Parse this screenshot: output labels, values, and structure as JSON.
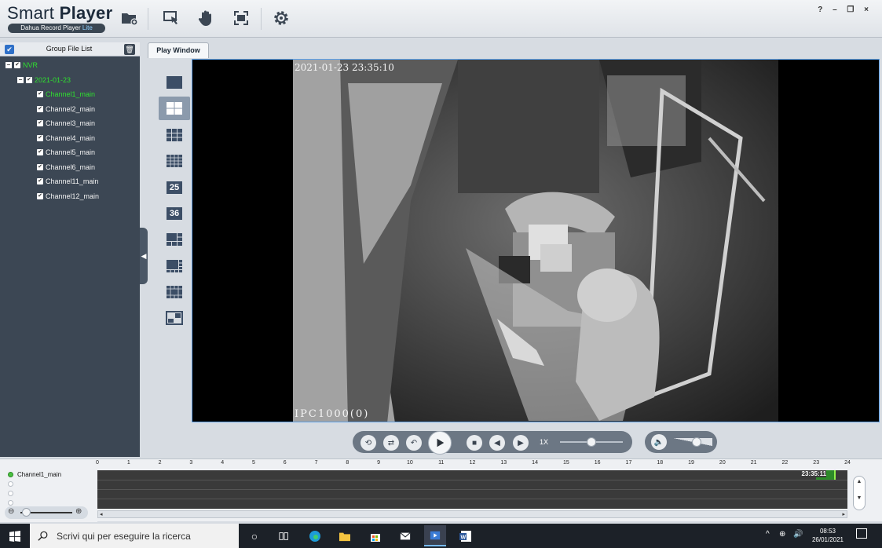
{
  "app": {
    "title_light": "Smart ",
    "title_bold": "Player",
    "subtitle": "Dahua Record Player ",
    "subtitle_lite": "Lite",
    "window_controls": "? – ❐ ×"
  },
  "toolbar": {
    "icons": [
      "open-folder-icon",
      "snapshot-cursor-icon",
      "hand-icon",
      "fullscreen-icon",
      "settings-gear-icon"
    ]
  },
  "group_panel": {
    "title": "Group File List",
    "tree": {
      "root": "NVR",
      "date": "2021-01-23",
      "channels": [
        "Channel1_main",
        "Channel2_main",
        "Channel3_main",
        "Channel4_main",
        "Channel5_main",
        "Channel6_main",
        "Channel11_main",
        "Channel12_main"
      ],
      "active_channel": "Channel1_main"
    }
  },
  "play_window": {
    "tab_label": "Play Window",
    "layouts": [
      "1",
      "4",
      "9",
      "16",
      "25",
      "36",
      "6",
      "8",
      "13",
      "pip"
    ],
    "layout_25": "25",
    "layout_36": "36",
    "selected_layout": "4",
    "timestamp": "2021-01-23 23:35:10",
    "camera_name": "IPC1000(0)"
  },
  "playback": {
    "speed_label": "1X",
    "speed_level": 0.5,
    "volume_level": 0.6
  },
  "timeline": {
    "channel_label": "Channel1_main",
    "hours": [
      "0",
      "1",
      "2",
      "3",
      "4",
      "5",
      "6",
      "7",
      "8",
      "9",
      "10",
      "11",
      "12",
      "13",
      "14",
      "15",
      "16",
      "17",
      "18",
      "19",
      "20",
      "21",
      "22",
      "23",
      "24"
    ],
    "current_time": "23:35:11",
    "zoom_level": 0.1
  },
  "taskbar": {
    "search_placeholder": "Scrivi qui per eseguire la ricerca",
    "time": "08:53",
    "date": "26/01/2021"
  },
  "colors": {
    "accent": "#2f70c8",
    "tree_active": "#2fe02f",
    "panel_dark": "#3c4754"
  }
}
